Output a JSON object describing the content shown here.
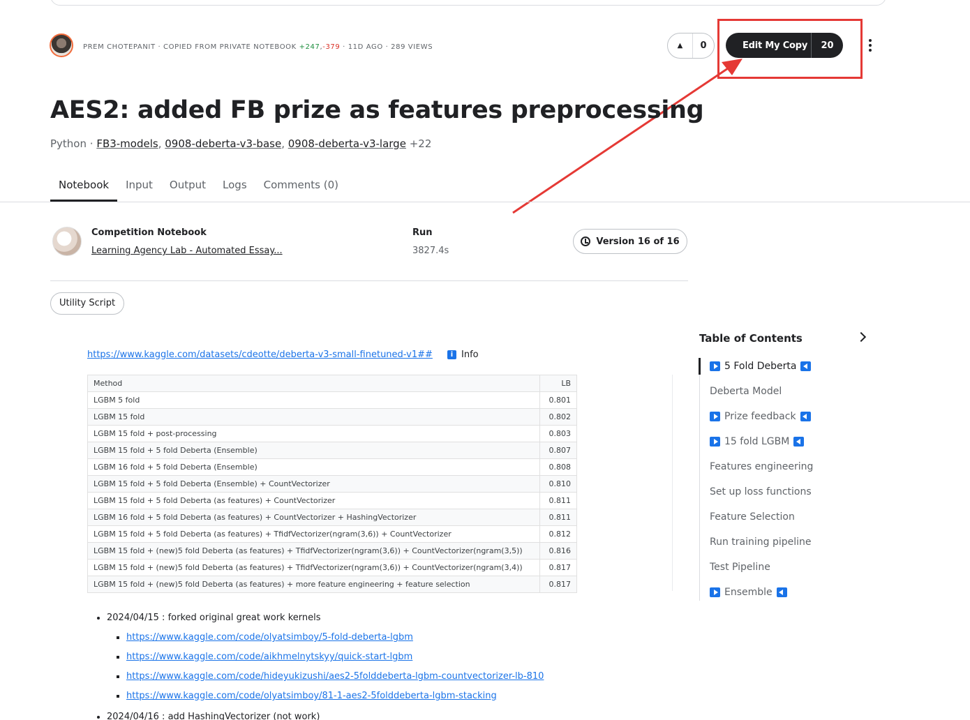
{
  "header": {
    "author": "PREM CHOTEPANIT",
    "copied_from": "COPIED FROM PRIVATE NOTEBOOK",
    "additions": "+247",
    "deletions": "-379",
    "age": "11D AGO",
    "views": "289 VIEWS",
    "upvote_count": "0",
    "edit_label": "Edit My Copy",
    "edit_count": "20"
  },
  "title": "AES2: added FB prize as features preprocessing",
  "subtitle": {
    "language": "Python",
    "datasets": [
      "FB3-models",
      "0908-deberta-v3-base",
      "0908-deberta-v3-large"
    ],
    "more": "+22"
  },
  "tabs": [
    "Notebook",
    "Input",
    "Output",
    "Logs",
    "Comments (0)"
  ],
  "competition": {
    "heading": "Competition Notebook",
    "link": "Learning Agency Lab - Automated Essay...",
    "run_heading": "Run",
    "run_time": "3827.4s",
    "version": "Version 16 of 16"
  },
  "utility_label": "Utility Script",
  "notebook": {
    "dataset_link": "https://www.kaggle.com/datasets/cdeotte/deberta-v3-small-finetuned-v1##",
    "info_icon": "i",
    "info_label": "Info",
    "table": {
      "headers": [
        "Method",
        "LB"
      ],
      "rows": [
        [
          "LGBM 5 fold",
          "0.801"
        ],
        [
          "LGBM 15 fold",
          "0.802"
        ],
        [
          "LGBM 15 fold + post-processing",
          "0.803"
        ],
        [
          "LGBM 15 fold + 5 fold Deberta (Ensemble)",
          "0.807"
        ],
        [
          "LGBM 16 fold + 5 fold Deberta (Ensemble)",
          "0.808"
        ],
        [
          "LGBM 15 fold + 5 fold Deberta (Ensemble) + CountVectorizer",
          "0.810"
        ],
        [
          "LGBM 15 fold + 5 fold Deberta (as features) + CountVectorizer",
          "0.811"
        ],
        [
          "LGBM 16 fold + 5 fold Deberta (as features) + CountVectorizer + HashingVectorizer",
          "0.811"
        ],
        [
          "LGBM 15 fold + 5 fold Deberta (as features) + TfidfVectorizer(ngram(3,6)) + CountVectorizer",
          "0.812"
        ],
        [
          "LGBM 15 fold + (new)5 fold Deberta (as features) + TfidfVectorizer(ngram(3,6)) + CountVectorizer(ngram(3,5))",
          "0.816"
        ],
        [
          "LGBM 15 fold + (new)5 fold Deberta (as features) + TfidfVectorizer(ngram(3,6)) + CountVectorizer(ngram(3,4))",
          "0.817"
        ],
        [
          "LGBM 15 fold + (new)5 fold Deberta (as features) + more feature engineering + feature selection",
          "0.817"
        ]
      ]
    },
    "notes": {
      "item1": "2024/04/15 : forked original great work kernels",
      "links": [
        "https://www.kaggle.com/code/olyatsimboy/5-fold-deberta-lgbm",
        "https://www.kaggle.com/code/aikhmelnytskyy/quick-start-lgbm",
        "https://www.kaggle.com/code/hideyukizushi/aes2-5folddeberta-lgbm-countvectorizer-lb-810",
        "https://www.kaggle.com/code/olyatsimboy/81-1-aes2-5folddeberta-lgbm-stacking"
      ],
      "item2": "2024/04/16 : add HashingVectorizer (not work)"
    }
  },
  "toc": {
    "heading": "Table of Contents",
    "items": [
      "5 Fold Deberta",
      "Deberta Model",
      "Prize feedback",
      "15 fold LGBM",
      "Features engineering",
      "Set up loss functions",
      "Feature Selection",
      "Run training pipeline",
      "Test Pipeline",
      "Ensemble"
    ]
  },
  "colors": {
    "accent": "#1a73e8",
    "annotation_red": "#e53935",
    "additions": "#1e8e3e",
    "deletions": "#d93025"
  }
}
